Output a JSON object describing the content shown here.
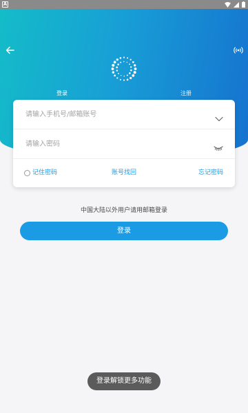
{
  "status_bar": {
    "notification_text": "A",
    "icons": [
      "wifi-icon",
      "signal-icon",
      "battery-icon"
    ]
  },
  "header": {
    "back_icon": "back-arrow-icon",
    "right_icon": "broadcast-icon",
    "logo_icon": "dot-ring-logo"
  },
  "tabs": [
    {
      "label": "登录",
      "active": true
    },
    {
      "label": "注册",
      "active": false
    }
  ],
  "form": {
    "account_placeholder": "请输入手机号/邮箱账号",
    "account_value": "",
    "account_icon": "chevron-down-icon",
    "password_placeholder": "请输入密码",
    "password_value": "",
    "password_icon": "eye-closed-icon",
    "remember_label": "记住密码",
    "remember_checked": false,
    "recover_label": "账号找回",
    "forgot_label": "忘记密码"
  },
  "notice": "中国大陆以外用户请用邮箱登录",
  "login_button": "登录",
  "toast": "登录解锁更多功能",
  "colors": {
    "accent": "#1a9be4",
    "header_gradient": [
      "#14bcc8",
      "#189fd6",
      "#1672cf"
    ],
    "status_bar": "#8a8a8a",
    "toast_bg": "#5b5b5b",
    "page_bg": "#f5f5f7"
  }
}
